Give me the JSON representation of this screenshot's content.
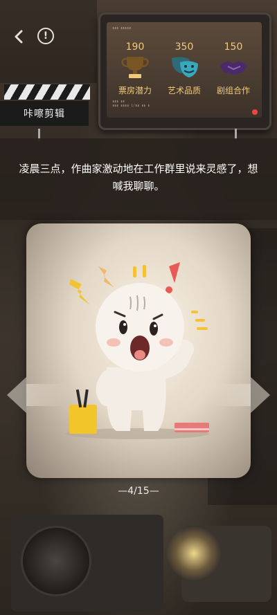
{
  "topbar": {
    "back_icon": "chevron-left-icon",
    "info_icon": "exclamation-circle-icon",
    "info_glyph": "!"
  },
  "monitor": {
    "stats": [
      {
        "value": "190",
        "label": "票房潜力",
        "icon": "trophy-icon"
      },
      {
        "value": "350",
        "label": "艺术品质",
        "icon": "masks-icon"
      },
      {
        "value": "150",
        "label": "剧组合作",
        "icon": "handshake-icon"
      }
    ]
  },
  "clapper": {
    "label": "咔嚓剪辑"
  },
  "narration": {
    "text": "凌晨三点，作曲家激动地在工作群里说来灵感了，想喊我聊聊。"
  },
  "card": {
    "image": "panicked-character-illustration"
  },
  "pager": {
    "text": "—4/15—"
  },
  "colors": {
    "accent_gold": "#f2c979",
    "narration_bg": "#28221d",
    "card_bg": "#f3eadc"
  }
}
